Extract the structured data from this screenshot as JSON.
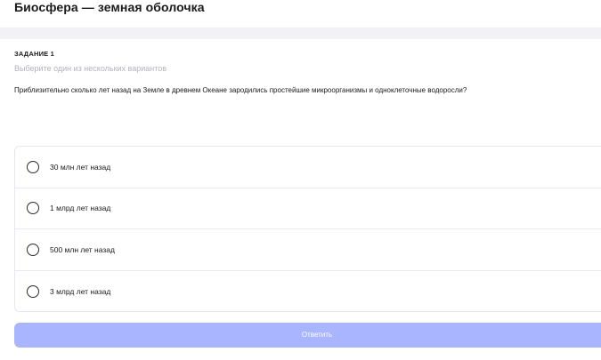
{
  "header": {
    "title": "Биосфера — земная оболочка"
  },
  "task": {
    "label": "ЗАДАНИЕ 1",
    "hint": "Выберите один из нескольких вариантов",
    "question": "Приблизительно сколько лет назад на Земле в древнем Океане зародились простейшие микроорганизмы и одноклеточные водоросли?"
  },
  "options": [
    {
      "label": "30 млн лет назад"
    },
    {
      "label": "1 млрд лет назад"
    },
    {
      "label": "500 млн лет назад"
    },
    {
      "label": "3 млрд лет назад"
    }
  ],
  "submit": {
    "label": "Ответить"
  },
  "colors": {
    "accent_disabled": "#aab5ff",
    "band": "#f2f2f6",
    "hint": "#b3b3bb"
  }
}
